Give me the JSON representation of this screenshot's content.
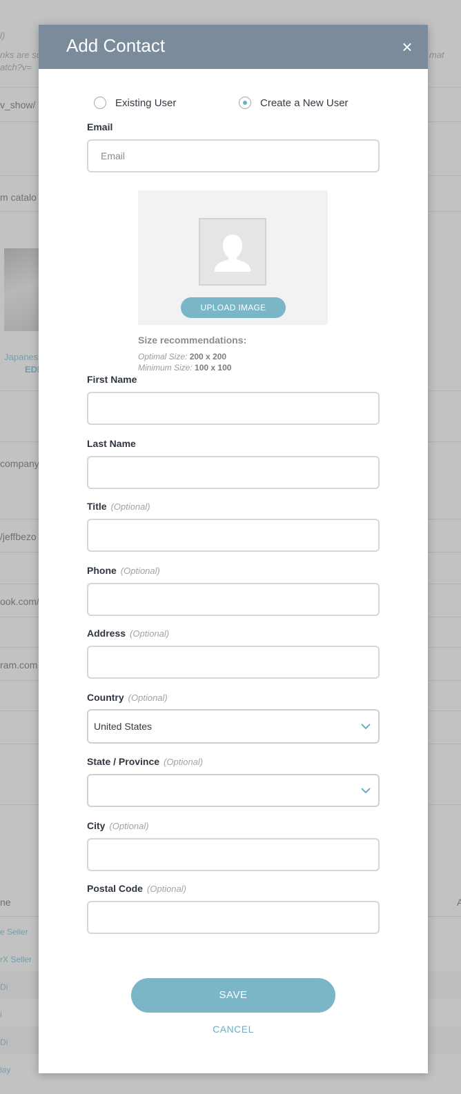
{
  "background": {
    "frag_note": "l)",
    "frag_note2": "nks are su",
    "frag_note3": "atch?v=",
    "frag_note_right": "mat",
    "frag_url": "v_show/",
    "frag_catalog": "m catalo",
    "frag_japanese": "Japanes",
    "frag_edit": "EDI",
    "frag_company": "company",
    "frag_jeff": "/jeffbezo",
    "frag_facebook": "ook.com/",
    "frag_instagram": "ram.com",
    "frag_col_header": "ne",
    "frag_col_header_right": "A",
    "rows": [
      "e Seller",
      "rX Seller",
      "Di",
      "i",
      "Di",
      "lay"
    ]
  },
  "modal": {
    "title": "Add Contact",
    "close_symbol": "×",
    "radio_existing": "Existing User",
    "radio_new": "Create a New User",
    "selected_option": "Create a New User",
    "email_label": "Email",
    "email_placeholder": "Email",
    "upload_button": "UPLOAD IMAGE",
    "size_title": "Size recommendations:",
    "optimal_label": "Optimal Size:",
    "optimal_value": "200 x 200",
    "minimum_label": "Minimum Size:",
    "minimum_value": "100 x 100",
    "optional_text": "(Optional)",
    "first_name_label": "First Name",
    "last_name_label": "Last Name",
    "title_label": "Title",
    "phone_label": "Phone",
    "address_label": "Address",
    "country_label": "Country",
    "country_value": "United States",
    "state_label": "State / Province",
    "state_value": "",
    "city_label": "City",
    "postal_label": "Postal Code",
    "save_button": "SAVE",
    "cancel_link": "CANCEL"
  },
  "colors": {
    "header": "#7b8b9c",
    "accent": "#7ab6c7",
    "overlay": "#c2c2c2"
  },
  "icons": {
    "close": "close-icon",
    "avatar": "user-silhouette-icon",
    "select_arrow": "chevron-down-icon"
  }
}
